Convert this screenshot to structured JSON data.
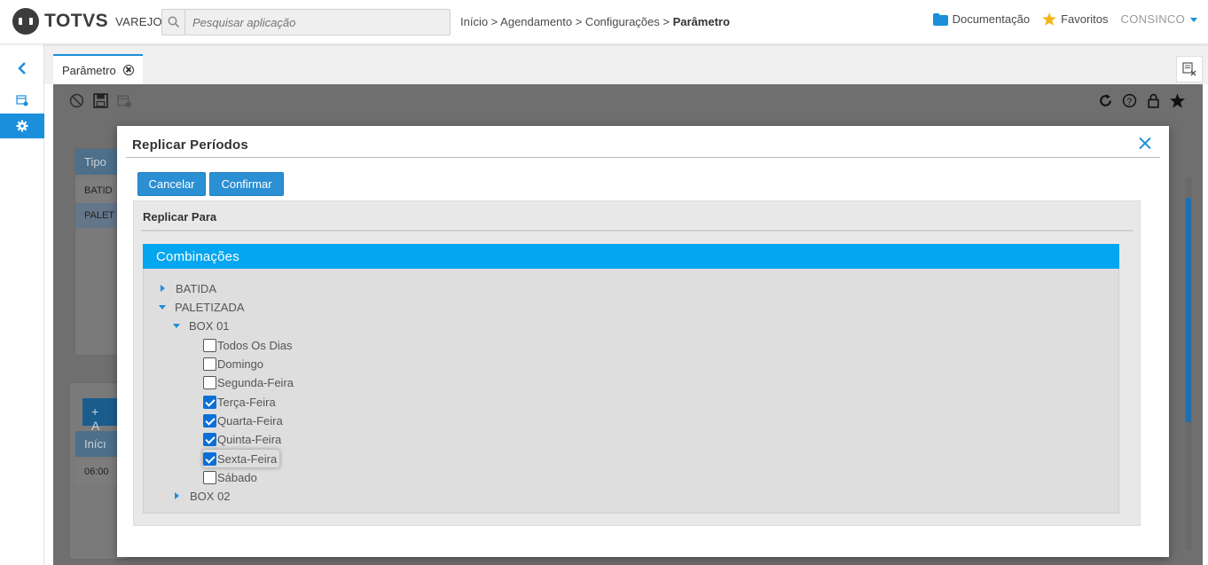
{
  "header": {
    "brand": "TOTVS",
    "brand_sub": "VAREJO",
    "search_placeholder": "Pesquisar aplicação",
    "breadcrumb": {
      "path": "Início > Agendamento > Configurações > ",
      "current": "Parâmetro"
    },
    "documentation": "Documentação",
    "favorites": "Favoritos",
    "user": "CONSINCO"
  },
  "tabs": [
    {
      "label": "Parâmetro"
    }
  ],
  "background": {
    "table1_header": "Tipo",
    "table1_rows": [
      "BATID",
      "PALET"
    ],
    "add_button": "+ A",
    "table2_header": "Inícı",
    "table2_row": "06:00"
  },
  "modal": {
    "title": "Replicar Períodos",
    "cancel_label": "Cancelar",
    "confirm_label": "Confirmar",
    "section_title": "Replicar Para",
    "tree_title": "Combinações",
    "tree": {
      "batida": "BATIDA",
      "paletizada": "PALETIZADA",
      "box01": "BOX 01",
      "days": [
        {
          "label": "Todos Os Dias",
          "checked": false
        },
        {
          "label": "Domingo",
          "checked": false
        },
        {
          "label": "Segunda-Feira",
          "checked": false
        },
        {
          "label": "Terça-Feira",
          "checked": true
        },
        {
          "label": "Quarta-Feira",
          "checked": true
        },
        {
          "label": "Quinta-Feira",
          "checked": true
        },
        {
          "label": "Sexta-Feira",
          "checked": true
        },
        {
          "label": "Sábado",
          "checked": false
        }
      ],
      "box02": "BOX 02"
    }
  },
  "colors": {
    "accent": "#1c8fdb",
    "tree_header": "#05a6f0",
    "checkbox_checked": "#0b6fd6",
    "favorite_star": "#f5b51a"
  }
}
